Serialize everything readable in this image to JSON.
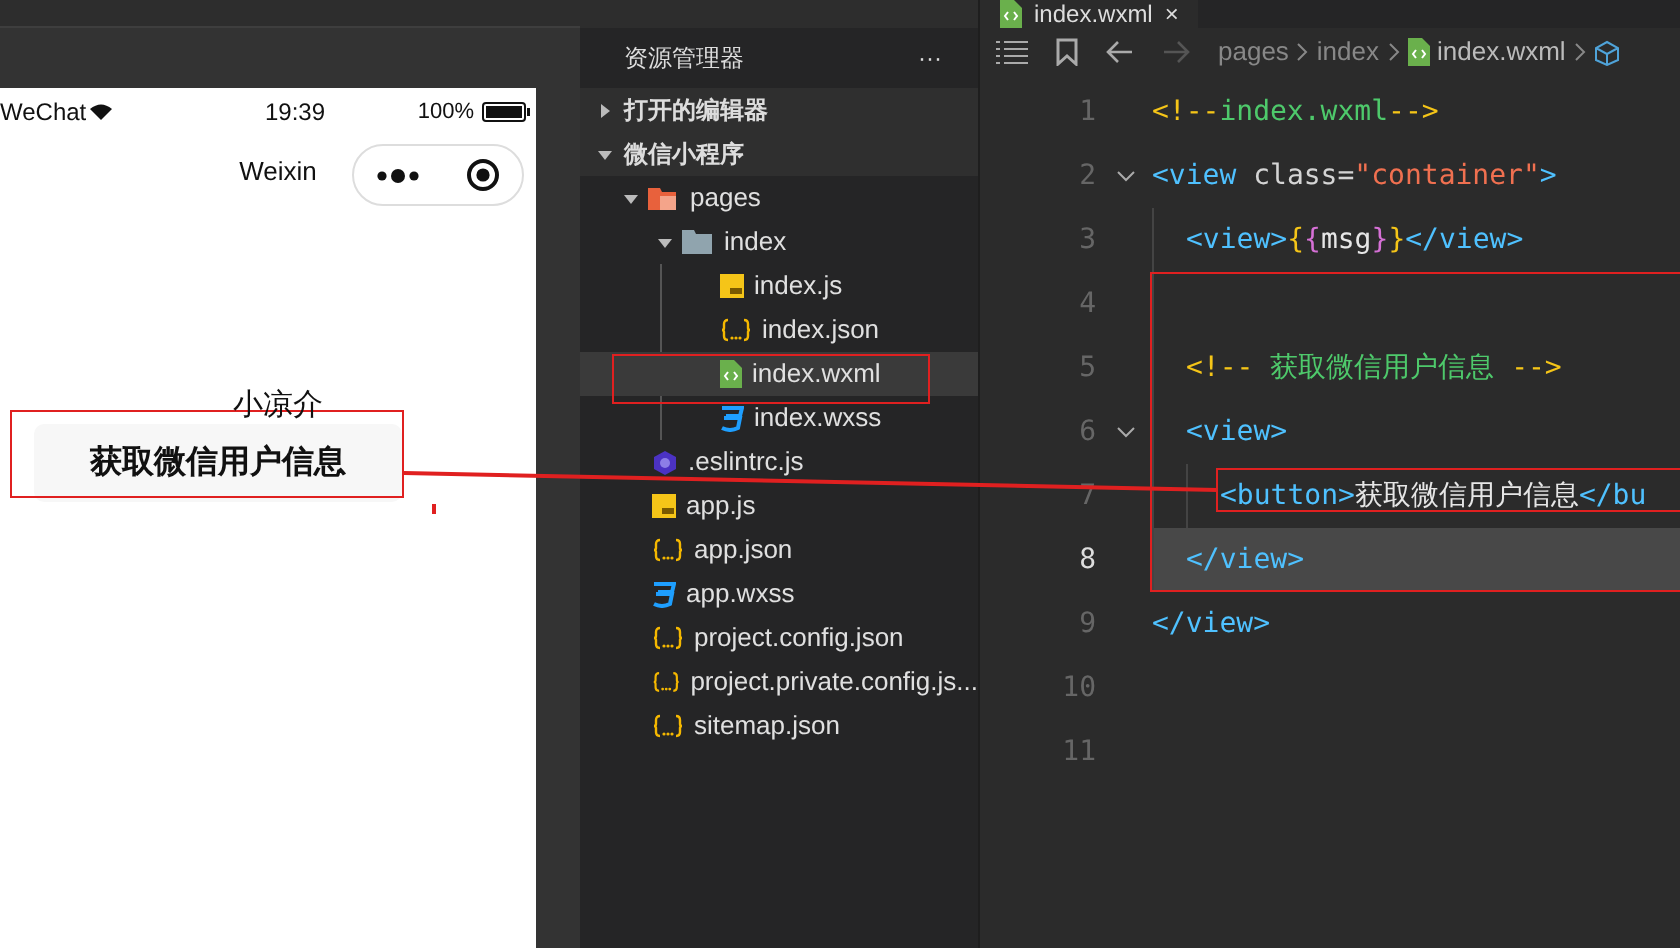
{
  "simulator": {
    "status_bar": {
      "carrier": "WeChat",
      "time": "19:39",
      "battery": "100%"
    },
    "nav_title": "Weixin",
    "msg": "小凉介",
    "button": "获取微信用户信息"
  },
  "explorer": {
    "title": "资源管理器",
    "more": "···",
    "sections": [
      {
        "label": "打开的编辑器",
        "expanded": false
      },
      {
        "label": "微信小程序",
        "expanded": true,
        "children": [
          {
            "label": "pages",
            "kind": "pages-folder",
            "expanded": true,
            "selected": false,
            "children": [
              {
                "label": "index",
                "kind": "folder",
                "expanded": true,
                "selected": false,
                "children": [
                  {
                    "label": "index.js",
                    "kind": "js",
                    "selected": false
                  },
                  {
                    "label": "index.json",
                    "kind": "json",
                    "selected": false
                  },
                  {
                    "label": "index.wxml",
                    "kind": "wxml",
                    "selected": true
                  },
                  {
                    "label": "index.wxss",
                    "kind": "wxss",
                    "selected": false
                  }
                ]
              }
            ]
          },
          {
            "label": ".eslintrc.js",
            "kind": "eslint",
            "selected": false
          },
          {
            "label": "app.js",
            "kind": "js",
            "selected": false
          },
          {
            "label": "app.json",
            "kind": "json",
            "selected": false
          },
          {
            "label": "app.wxss",
            "kind": "wxss",
            "selected": false
          },
          {
            "label": "project.config.json",
            "kind": "json",
            "selected": false
          },
          {
            "label": "project.private.config.js...",
            "kind": "json",
            "selected": false
          },
          {
            "label": "sitemap.json",
            "kind": "json",
            "selected": false
          }
        ]
      }
    ]
  },
  "editor": {
    "tab": {
      "label": "index.wxml",
      "close": "×"
    },
    "breadcrumb": [
      "pages",
      "index",
      "index.wxml"
    ],
    "lines": [
      {
        "number": "1",
        "current": false,
        "tokens": [
          {
            "kind": "punct",
            "text": "<!--"
          },
          {
            "kind": "comment",
            "text": "index.wxml"
          },
          {
            "kind": "punct",
            "text": "-->"
          }
        ]
      },
      {
        "number": "2",
        "current": false,
        "tokens": [
          {
            "kind": "tag",
            "text": "<view"
          },
          {
            "kind": "attr",
            "text": " class="
          },
          {
            "kind": "string",
            "text": "\"container\""
          },
          {
            "kind": "tag",
            "text": ">"
          }
        ],
        "children": [
          {
            "number": "3",
            "current": false,
            "tokens": [
              {
                "kind": "tag",
                "text": "<view>"
              },
              {
                "kind": "brace",
                "text": "{"
              },
              {
                "kind": "brace2",
                "text": "{"
              },
              {
                "kind": "text",
                "text": "msg"
              },
              {
                "kind": "brace2",
                "text": "}"
              },
              {
                "kind": "brace",
                "text": "}"
              },
              {
                "kind": "tag",
                "text": "</view>"
              }
            ]
          },
          {
            "number": "4",
            "current": false
          },
          {
            "number": "5",
            "current": false,
            "tokens": [
              {
                "kind": "punct",
                "text": "<!--"
              },
              {
                "kind": "comment",
                "text": " 获取微信用户信息 "
              },
              {
                "kind": "punct",
                "text": "-->"
              }
            ]
          },
          {
            "number": "6",
            "current": false,
            "tokens": [
              {
                "kind": "tag",
                "text": "<view>"
              }
            ],
            "children": [
              {
                "number": "7",
                "current": false,
                "tokens": [
                  {
                    "kind": "tag",
                    "text": "<button>"
                  },
                  {
                    "kind": "text",
                    "text": "获取微信用户信息"
                  },
                  {
                    "kind": "tag",
                    "text": "</bu"
                  }
                ]
              }
            ]
          },
          {
            "number": "8",
            "current": true,
            "tokens": [
              {
                "kind": "tag",
                "text": "</view>"
              }
            ]
          }
        ]
      },
      {
        "number": "9",
        "current": false,
        "tokens": [
          {
            "kind": "tag",
            "text": "</view>"
          }
        ]
      },
      {
        "number": "10",
        "current": false
      },
      {
        "number": "11",
        "current": false
      }
    ]
  }
}
